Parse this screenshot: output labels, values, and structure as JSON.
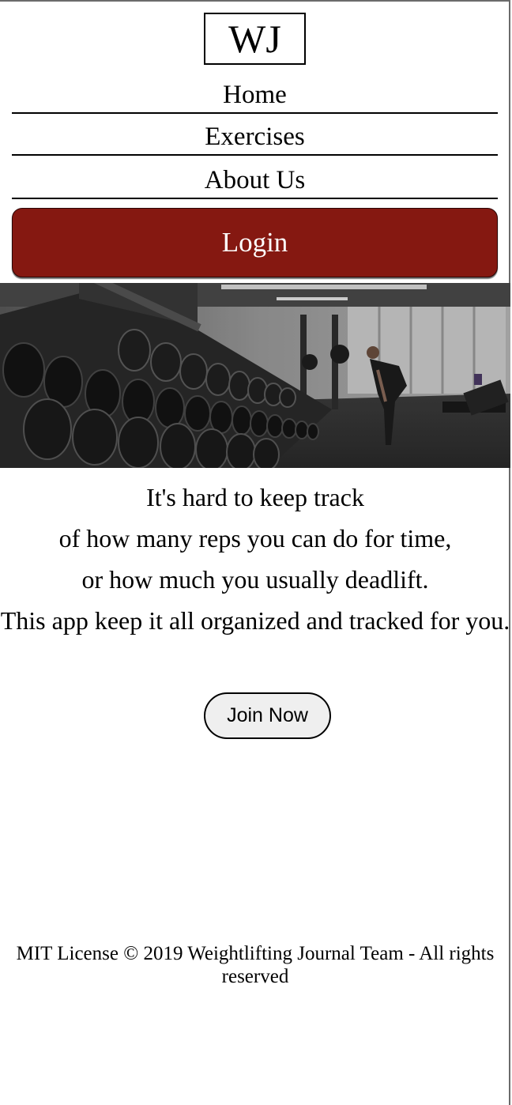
{
  "header": {
    "logo_text": "WJ"
  },
  "nav": {
    "home": "Home",
    "exercises": "Exercises",
    "about": "About Us",
    "login": "Login"
  },
  "colors": {
    "login_bg": "#851811",
    "join_bg": "#efefef"
  },
  "hero": {
    "image": "gym-dumbbell-rack-photo"
  },
  "intro": {
    "line1": "It's hard to keep track",
    "line2": "of how many reps you can do for time,",
    "line3": "or how much you usually deadlift.",
    "line4": "This app keep it all organized and tracked for you."
  },
  "cta": {
    "join_label": "Join Now"
  },
  "footer": {
    "text": "MIT License © 2019 Weightlifting Journal Team - All rights reserved"
  }
}
